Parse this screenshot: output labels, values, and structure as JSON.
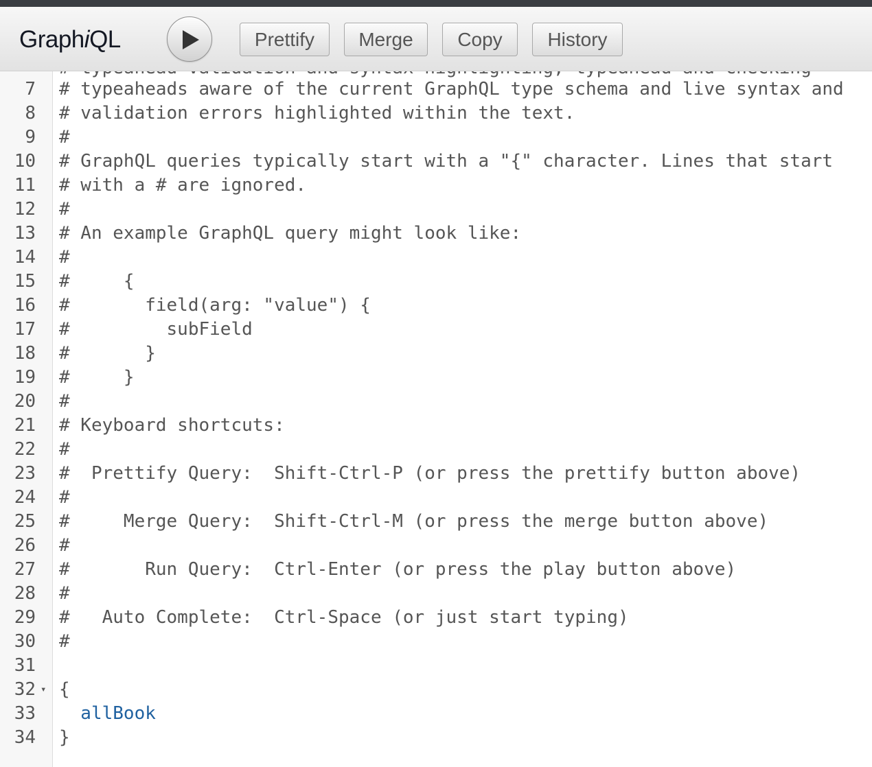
{
  "app": {
    "title_prefix": "Graph",
    "title_italic": "i",
    "title_suffix": "QL"
  },
  "toolbar": {
    "play_label": "",
    "buttons": [
      {
        "label": "Prettify"
      },
      {
        "label": "Merge"
      },
      {
        "label": "Copy"
      },
      {
        "label": "History"
      }
    ]
  },
  "editor": {
    "partial_top_line": "# typeahead validation and syntax highlighting, typeahead and checking",
    "lines": [
      {
        "num": "7",
        "text": "# typeaheads aware of the current GraphQL type schema and live syntax and",
        "cls": ""
      },
      {
        "num": "8",
        "text": "# validation errors highlighted within the text.",
        "cls": ""
      },
      {
        "num": "9",
        "text": "#",
        "cls": ""
      },
      {
        "num": "10",
        "text": "# GraphQL queries typically start with a \"{\" character. Lines that start",
        "cls": ""
      },
      {
        "num": "11",
        "text": "# with a # are ignored.",
        "cls": ""
      },
      {
        "num": "12",
        "text": "#",
        "cls": ""
      },
      {
        "num": "13",
        "text": "# An example GraphQL query might look like:",
        "cls": ""
      },
      {
        "num": "14",
        "text": "#",
        "cls": ""
      },
      {
        "num": "15",
        "text": "#     {",
        "cls": ""
      },
      {
        "num": "16",
        "text": "#       field(arg: \"value\") {",
        "cls": ""
      },
      {
        "num": "17",
        "text": "#         subField",
        "cls": ""
      },
      {
        "num": "18",
        "text": "#       }",
        "cls": ""
      },
      {
        "num": "19",
        "text": "#     }",
        "cls": ""
      },
      {
        "num": "20",
        "text": "#",
        "cls": ""
      },
      {
        "num": "21",
        "text": "# Keyboard shortcuts:",
        "cls": ""
      },
      {
        "num": "22",
        "text": "#",
        "cls": ""
      },
      {
        "num": "23",
        "text": "#  Prettify Query:  Shift-Ctrl-P (or press the prettify button above)",
        "cls": ""
      },
      {
        "num": "24",
        "text": "#",
        "cls": ""
      },
      {
        "num": "25",
        "text": "#     Merge Query:  Shift-Ctrl-M (or press the merge button above)",
        "cls": ""
      },
      {
        "num": "26",
        "text": "#",
        "cls": ""
      },
      {
        "num": "27",
        "text": "#       Run Query:  Ctrl-Enter (or press the play button above)",
        "cls": ""
      },
      {
        "num": "28",
        "text": "#",
        "cls": ""
      },
      {
        "num": "29",
        "text": "#   Auto Complete:  Ctrl-Space (or just start typing)",
        "cls": ""
      },
      {
        "num": "30",
        "text": "#",
        "cls": ""
      },
      {
        "num": "31",
        "text": "",
        "cls": ""
      },
      {
        "num": "32",
        "text": "{",
        "cls": "punct",
        "fold": "▾"
      },
      {
        "num": "33",
        "text": "  allBook",
        "cls": "field"
      },
      {
        "num": "34",
        "text": "}",
        "cls": "punct"
      }
    ]
  },
  "colors": {
    "comment": "#555555",
    "field": "#1f61a0",
    "gutter_bg": "#f7f7f7"
  }
}
